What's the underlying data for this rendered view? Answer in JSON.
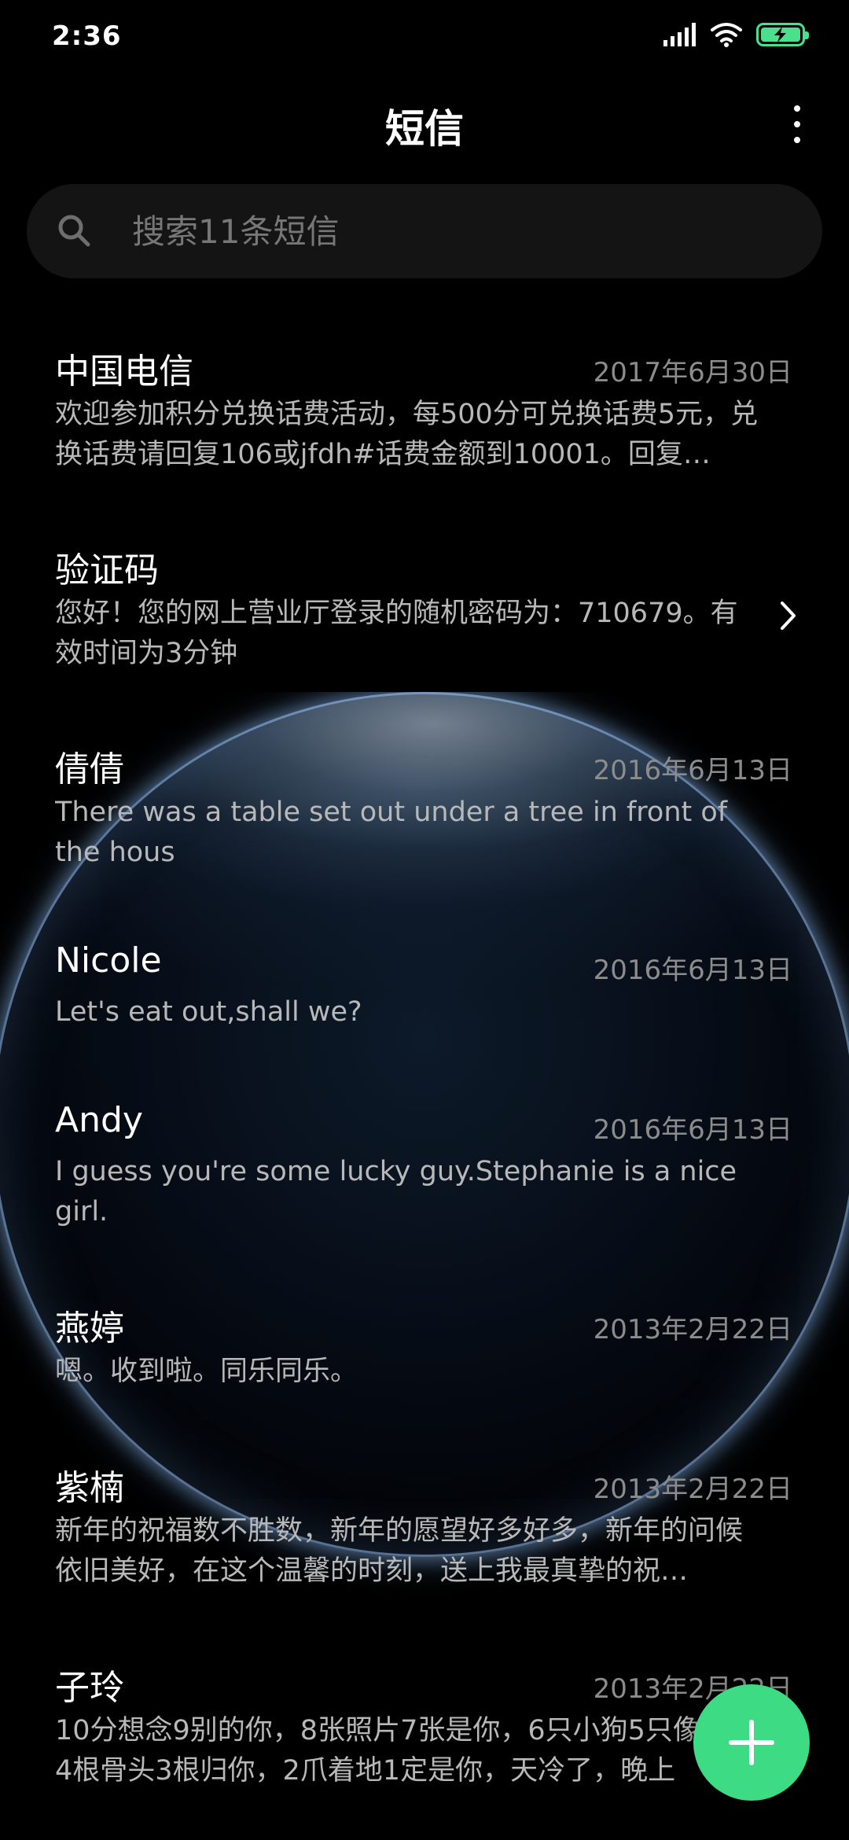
{
  "status_bar": {
    "time": "2:36",
    "battery_level": 1.0,
    "battery_color": "#4be08c"
  },
  "header": {
    "title": "短信"
  },
  "search": {
    "placeholder": "搜索11条短信"
  },
  "messages": [
    {
      "sender": "中国电信",
      "date": "2017年6月30日",
      "preview": "欢迎参加积分兑换话费活动，每500分可兑换话费5元，兑换话费请回复106或jfdh#话费金额到10001。回复…"
    },
    {
      "sender": "验证码",
      "date": "",
      "preview": "您好！您的网上营业厅登录的随机密码为：710679。有效时间为3分钟"
    },
    {
      "sender": "倩倩",
      "date": "2016年6月13日",
      "preview": "There was a table set out under a tree in front of the hous"
    },
    {
      "sender": "Nicole",
      "date": "2016年6月13日",
      "preview": "Let's eat out,shall we?"
    },
    {
      "sender": "Andy",
      "date": "2016年6月13日",
      "preview": "I guess you're some lucky guy.Stephanie is a nice girl."
    },
    {
      "sender": "燕婷",
      "date": "2013年2月22日",
      "preview": "嗯。收到啦。同乐同乐。"
    },
    {
      "sender": "紫楠",
      "date": "2013年2月22日",
      "preview": "新年的祝福数不胜数，新年的愿望好多好多，新年的问候依旧美好，在这个温馨的时刻，送上我最真挚的祝…"
    },
    {
      "sender": "子玲",
      "date": "2013年2月22日",
      "preview": "10分想念9别的你，8张照片7张是你，6只小狗5只像你，4根骨头3根归你，2爪着地1定是你，天冷了，晚上"
    }
  ],
  "fab": {
    "icon": "plus-icon",
    "color": "#3ddc84"
  }
}
